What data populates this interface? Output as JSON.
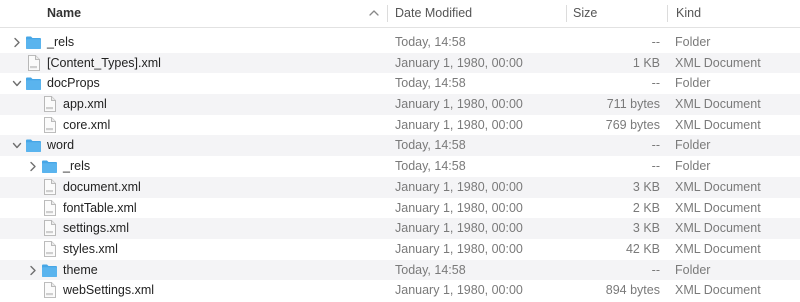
{
  "columns": {
    "name": "Name",
    "date": "Date Modified",
    "size": "Size",
    "kind": "Kind"
  },
  "colors": {
    "folder": "#5ab4ee",
    "folder_tab": "#46a6e6",
    "alt_row": "#f4f4f6"
  },
  "rows": [
    {
      "name": "_rels",
      "date": "Today, 14:58",
      "size": "--",
      "kind": "Folder",
      "type": "folder",
      "icon": "folder-icon",
      "expanded": false
    },
    {
      "name": "[Content_Types].xml",
      "date": "January 1, 1980, 00:00",
      "size": "1 KB",
      "kind": "XML Document",
      "type": "file",
      "icon": "xml-file-icon"
    },
    {
      "name": "docProps",
      "date": "Today, 14:58",
      "size": "--",
      "kind": "Folder",
      "type": "folder",
      "icon": "folder-icon",
      "expanded": true
    },
    {
      "name": "app.xml",
      "date": "January 1, 1980, 00:00",
      "size": "711 bytes",
      "kind": "XML Document",
      "type": "file",
      "icon": "xml-file-icon"
    },
    {
      "name": "core.xml",
      "date": "January 1, 1980, 00:00",
      "size": "769 bytes",
      "kind": "XML Document",
      "type": "file",
      "icon": "xml-file-icon"
    },
    {
      "name": "word",
      "date": "Today, 14:58",
      "size": "--",
      "kind": "Folder",
      "type": "folder",
      "icon": "folder-icon",
      "expanded": true
    },
    {
      "name": "_rels",
      "date": "Today, 14:58",
      "size": "--",
      "kind": "Folder",
      "type": "folder",
      "icon": "folder-icon",
      "expanded": false
    },
    {
      "name": "document.xml",
      "date": "January 1, 1980, 00:00",
      "size": "3 KB",
      "kind": "XML Document",
      "type": "file",
      "icon": "xml-file-icon"
    },
    {
      "name": "fontTable.xml",
      "date": "January 1, 1980, 00:00",
      "size": "2 KB",
      "kind": "XML Document",
      "type": "file",
      "icon": "xml-file-icon"
    },
    {
      "name": "settings.xml",
      "date": "January 1, 1980, 00:00",
      "size": "3 KB",
      "kind": "XML Document",
      "type": "file",
      "icon": "xml-file-icon"
    },
    {
      "name": "styles.xml",
      "date": "January 1, 1980, 00:00",
      "size": "42 KB",
      "kind": "XML Document",
      "type": "file",
      "icon": "xml-file-icon"
    },
    {
      "name": "theme",
      "date": "Today, 14:58",
      "size": "--",
      "kind": "Folder",
      "type": "folder",
      "icon": "folder-icon",
      "expanded": false
    },
    {
      "name": "webSettings.xml",
      "date": "January 1, 1980, 00:00",
      "size": "894 bytes",
      "kind": "XML Document",
      "type": "file",
      "icon": "xml-file-icon"
    }
  ]
}
